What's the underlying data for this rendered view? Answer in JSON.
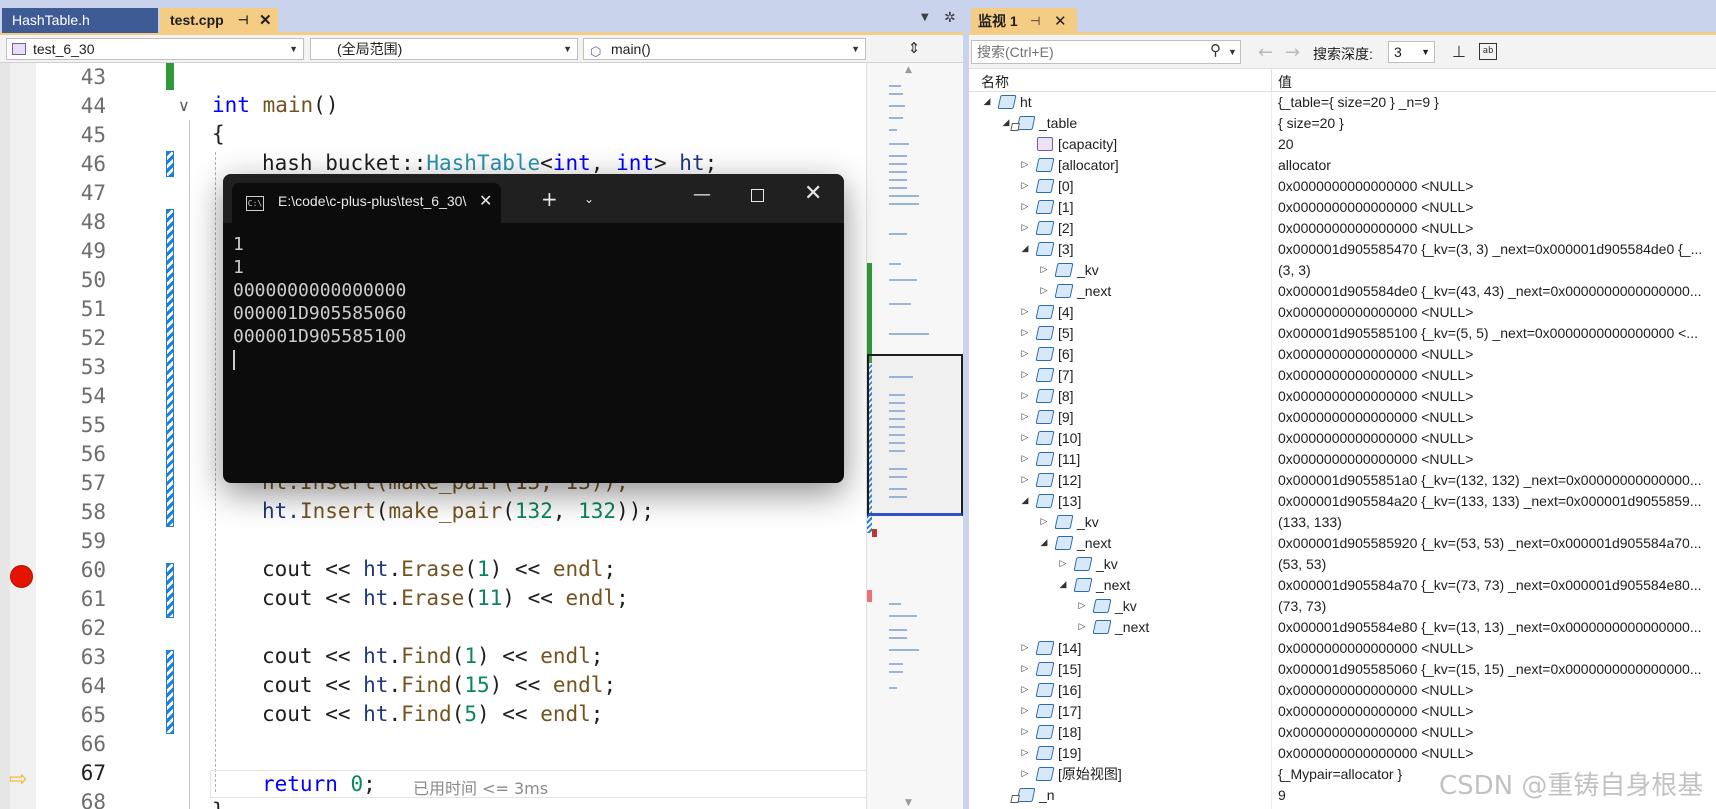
{
  "editor": {
    "tabs": [
      {
        "label": "HashTable.h"
      },
      {
        "label": "test.cpp",
        "pin": "⊣",
        "close": "✕"
      }
    ],
    "navbar": {
      "project": "test_6_30",
      "scope": "(全局范围)",
      "function": "main()"
    },
    "line_numbers": [
      "43",
      "44",
      "45",
      "46",
      "47",
      "48",
      "49",
      "50",
      "51",
      "52",
      "53",
      "54",
      "55",
      "56",
      "57",
      "58",
      "59",
      "60",
      "61",
      "62",
      "63",
      "64",
      "65",
      "66",
      "67",
      "68"
    ],
    "code": {
      "l44_kw": "int",
      "l44_fn": "main",
      "l44_rest": "()",
      "l45": "{",
      "l46_a": "hash_bucket::",
      "l46_typ": "HashTable",
      "l46_b": "<",
      "l46_kw1": "int",
      "l46_c": ", ",
      "l46_kw2": "int",
      "l46_d": "> ",
      "l46_var": "ht",
      "l46_e": ";",
      "l57": "ht.Insert(make_pair(13, 13));",
      "l58_a": "ht.",
      "l58_fn": "Insert",
      "l58_b": "(",
      "l58_fn2": "make_pair",
      "l58_c": "(",
      "l58_n1": "132",
      "l58_d": ", ",
      "l58_n2": "132",
      "l58_e": "));",
      "l60_a": "cout << ",
      "l60_var": "ht",
      "l60_b": ".",
      "l60_fn": "Erase",
      "l60_c": "(",
      "l60_n": "1",
      "l60_d": ") << ",
      "l60_fn2": "endl",
      "l60_e": ";",
      "l61_a": "cout << ",
      "l61_var": "ht",
      "l61_b": ".",
      "l61_fn": "Erase",
      "l61_c": "(",
      "l61_n": "11",
      "l61_d": ") << ",
      "l61_fn2": "endl",
      "l61_e": ";",
      "l63_a": "cout << ",
      "l63_var": "ht",
      "l63_b": ".",
      "l63_fn": "Find",
      "l63_c": "(",
      "l63_n": "1",
      "l63_d": ") << ",
      "l63_fn2": "endl",
      "l63_e": ";",
      "l64_a": "cout << ",
      "l64_var": "ht",
      "l64_b": ".",
      "l64_fn": "Find",
      "l64_c": "(",
      "l64_n": "15",
      "l64_d": ") << ",
      "l64_fn2": "endl",
      "l64_e": ";",
      "l65_a": "cout << ",
      "l65_var": "ht",
      "l65_b": ".",
      "l65_fn": "Find",
      "l65_c": "(",
      "l65_n": "5",
      "l65_d": ") << ",
      "l65_fn2": "endl",
      "l65_e": ";",
      "l67_kw": "return",
      "l67_sp": " ",
      "l67_n": "0",
      "l67_e": ";",
      "l68": "}"
    },
    "elapsed": "已用时间 <= 3ms"
  },
  "console": {
    "title": "E:\\code\\c-plus-plus\\test_6_30\\",
    "new_tab": "+",
    "output": [
      "1",
      "1",
      "0000000000000000",
      "000001D905585060",
      "000001D905585100"
    ]
  },
  "watch": {
    "tab_label": "监视 1",
    "search_placeholder": "搜索(Ctrl+E)",
    "depth_label": "搜索深度:",
    "depth_value": "3",
    "col_name": "名称",
    "col_value": "值",
    "rows": [
      {
        "name": "ht",
        "value": "{_table={ size=20 } _n=9 }"
      },
      {
        "name": "_table",
        "value": "{ size=20 }"
      },
      {
        "name": "[capacity]",
        "value": "20"
      },
      {
        "name": "[allocator]",
        "value": "allocator"
      },
      {
        "name": "[0]",
        "value": "0x0000000000000000 <NULL>"
      },
      {
        "name": "[1]",
        "value": "0x0000000000000000 <NULL>"
      },
      {
        "name": "[2]",
        "value": "0x0000000000000000 <NULL>"
      },
      {
        "name": "[3]",
        "value": "0x000001d905585470 {_kv=(3, 3) _next=0x000001d905584de0 {_..."
      },
      {
        "name": "_kv",
        "value": "(3, 3)"
      },
      {
        "name": "_next",
        "value": "0x000001d905584de0 {_kv=(43, 43) _next=0x0000000000000000..."
      },
      {
        "name": "[4]",
        "value": "0x0000000000000000 <NULL>"
      },
      {
        "name": "[5]",
        "value": "0x000001d905585100 {_kv=(5, 5) _next=0x0000000000000000 <..."
      },
      {
        "name": "[6]",
        "value": "0x0000000000000000 <NULL>"
      },
      {
        "name": "[7]",
        "value": "0x0000000000000000 <NULL>"
      },
      {
        "name": "[8]",
        "value": "0x0000000000000000 <NULL>"
      },
      {
        "name": "[9]",
        "value": "0x0000000000000000 <NULL>"
      },
      {
        "name": "[10]",
        "value": "0x0000000000000000 <NULL>"
      },
      {
        "name": "[11]",
        "value": "0x0000000000000000 <NULL>"
      },
      {
        "name": "[12]",
        "value": "0x000001d9055851a0 {_kv=(132, 132) _next=0x00000000000000..."
      },
      {
        "name": "[13]",
        "value": "0x000001d905584a20 {_kv=(133, 133) _next=0x000001d9055859..."
      },
      {
        "name": "_kv",
        "value": "(133, 133)"
      },
      {
        "name": "_next",
        "value": "0x000001d905585920 {_kv=(53, 53) _next=0x000001d905584a70..."
      },
      {
        "name": "_kv",
        "value": "(53, 53)"
      },
      {
        "name": "_next",
        "value": "0x000001d905584a70 {_kv=(73, 73) _next=0x000001d905584e80..."
      },
      {
        "name": "_kv",
        "value": "(73, 73)"
      },
      {
        "name": "_next",
        "value": "0x000001d905584e80 {_kv=(13, 13) _next=0x0000000000000000..."
      },
      {
        "name": "[14]",
        "value": "0x0000000000000000 <NULL>"
      },
      {
        "name": "[15]",
        "value": "0x000001d905585060 {_kv=(15, 15) _next=0x0000000000000000..."
      },
      {
        "name": "[16]",
        "value": "0x0000000000000000 <NULL>"
      },
      {
        "name": "[17]",
        "value": "0x0000000000000000 <NULL>"
      },
      {
        "name": "[18]",
        "value": "0x0000000000000000 <NULL>"
      },
      {
        "name": "[19]",
        "value": "0x0000000000000000 <NULL>"
      },
      {
        "name": "[原始视图]",
        "value": "{_Mypair=allocator }"
      },
      {
        "name": "_n",
        "value": "9"
      }
    ]
  },
  "watermark": "CSDN @重铸自身根基",
  "colors": {
    "tab_active": "#f5cc84",
    "tab_inactive": "#3f5b96",
    "keyword": "#0000ff",
    "type": "#2b91af",
    "function": "#74531f",
    "number": "#098658",
    "breakpoint": "#e51400",
    "console_bg": "#0c0c0c"
  }
}
